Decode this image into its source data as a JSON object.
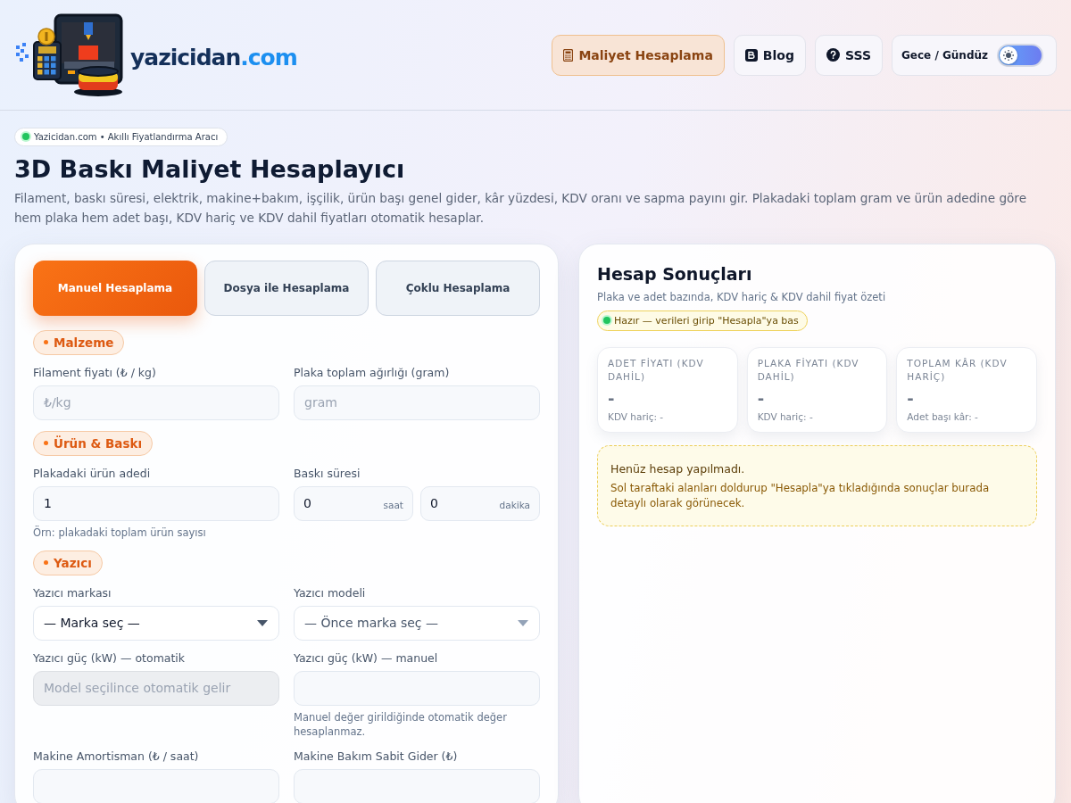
{
  "header": {
    "logo": {
      "name": "yazicidan",
      "tld": ".com"
    },
    "nav": [
      {
        "label": "Maliyet Hesaplama",
        "kind": "calculator",
        "selected": true
      },
      {
        "label": "Blog",
        "kind": "blog",
        "selected": false
      },
      {
        "label": "SSS",
        "kind": "question",
        "selected": false
      }
    ],
    "theme_toggle": {
      "label": "Gece / Gündüz",
      "on": false
    }
  },
  "hero": {
    "badge": "Yazicidan.com • Akıllı Fiyatlandırma Aracı",
    "title": "3D Baskı Maliyet Hesaplayıcı",
    "description": "Filament, baskı süresi, elektrik, makine+bakım, işçilik, ürün başı genel gider, kâr yüzdesi, KDV oranı ve sapma payını gir. Plakadaki toplam gram ve ürün adedine göre hem plaka hem adet başı, KDV hariç ve KDV dahil fiyatları otomatik hesaplar."
  },
  "tabs": [
    {
      "label": "Manuel Hesaplama",
      "selected": true
    },
    {
      "label": "Dosya ile Hesaplama",
      "selected": false
    },
    {
      "label": "Çoklu Hesaplama",
      "selected": false
    }
  ],
  "sections": [
    {
      "title": "Malzeme",
      "fields": [
        {
          "kind": "input",
          "label": "Filament fiyatı (₺ / kg)",
          "placeholder": "₺/kg",
          "disabled": false
        },
        {
          "kind": "input",
          "label": "Plaka toplam ağırlığı (gram)",
          "placeholder": "gram",
          "disabled": false
        }
      ]
    },
    {
      "title": "Ürün & Baskı",
      "fields": [
        {
          "kind": "input",
          "label": "Plakadaki ürün adedi",
          "value": "1",
          "hint": "Örn: plakadaki toplam ürün sayısı",
          "disabled": false
        },
        {
          "kind": "duration",
          "label": "Baskı süresi",
          "parts": [
            {
              "value": "0",
              "unit": "saat"
            },
            {
              "value": "0",
              "unit": "dakika"
            }
          ]
        }
      ]
    },
    {
      "title": "Yazıcı",
      "fields": [
        {
          "kind": "select",
          "label": "Yazıcı markası",
          "value": "— Marka seç —",
          "disabled": false
        },
        {
          "kind": "select",
          "label": "Yazıcı modeli",
          "value": "— Önce marka seç —",
          "disabled": true
        },
        {
          "kind": "input",
          "label": "Yazıcı güç (kW) — otomatik",
          "placeholder": "Model seçilince otomatik gelir",
          "disabled": true
        },
        {
          "kind": "input",
          "label": "Yazıcı güç (kW) — manuel",
          "hint": "Manuel değer girildiğinde otomatik değer hesaplanmaz.",
          "disabled": false
        },
        {
          "kind": "input",
          "label": "Makine Amortisman (₺ / saat)",
          "disabled": false
        },
        {
          "kind": "input",
          "label": "Makine Bakım Sabit Gider (₺)",
          "disabled": false
        }
      ]
    }
  ],
  "results": {
    "title": "Hesap Sonuçları",
    "subtitle": "Plaka ve adet bazında, KDV hariç & KDV dahil fiyat özeti",
    "status": "Hazır — verileri girip \"Hesapla\"ya bas",
    "cards": [
      {
        "label": "ADET FİYATI (KDV DAHİL)",
        "value": "-",
        "sub": "KDV hariç: -"
      },
      {
        "label": "PLAKA FİYATI (KDV DAHİL)",
        "value": "-",
        "sub": "KDV hariç: -"
      },
      {
        "label": "TOPLAM KÂR (KDV HARİÇ)",
        "value": "-",
        "sub": "Adet başı kâr: -"
      }
    ],
    "empty": {
      "title": "Henüz hesap yapılmadı.",
      "text": "Sol taraftaki alanları doldurup \"Hesapla\"ya tıkladığında sonuçlar burada detaylı olarak görünecek."
    }
  }
}
